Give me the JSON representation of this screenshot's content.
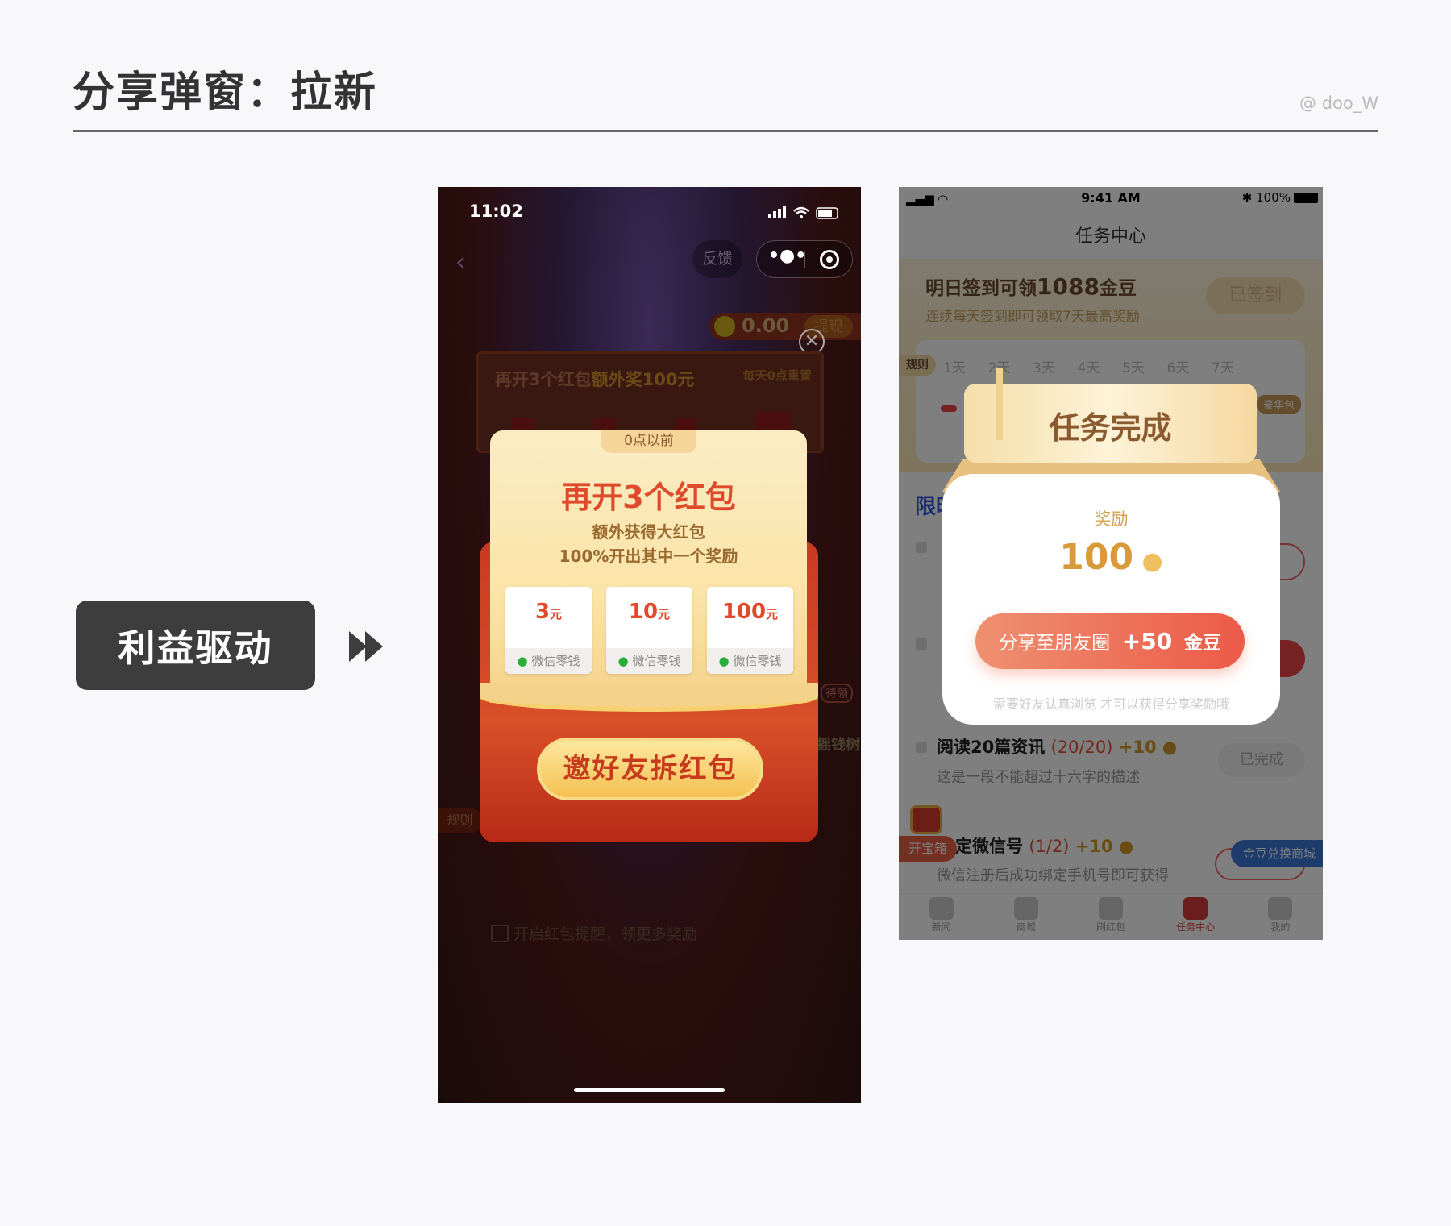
{
  "header": {
    "title": "分享弹窗：拉新",
    "watermark": "@ doo_W"
  },
  "category_tag": {
    "label": "利益驱动",
    "arrow_icon": "fast-forward-icon"
  },
  "phone1": {
    "status": {
      "time": "11:02"
    },
    "nav": {
      "feedback": "反馈"
    },
    "balance": {
      "amount": "0.00",
      "withdraw": "提现"
    },
    "banner": {
      "text_a": "再开3个红包",
      "text_b": "额外奖100元",
      "reset": "每天0点重置"
    },
    "popup": {
      "tab": "0点以前",
      "title": "再开3个红包",
      "line1": "额外获得大红包",
      "line2": "100%开出其中一个奖励",
      "rewards": [
        {
          "amount": "3",
          "unit": "元",
          "source": "微信零钱"
        },
        {
          "amount": "10",
          "unit": "元",
          "source": "微信零钱"
        },
        {
          "amount": "100",
          "unit": "元",
          "source": "微信零钱"
        }
      ],
      "cta": "邀好友拆红包"
    },
    "side": {
      "rules": "规则",
      "pending": "待领",
      "tree": "摇钱树"
    },
    "reminder": "开启红包提醒，领更多奖励"
  },
  "phone2": {
    "status": {
      "time": "9:41 AM",
      "battery": "100%"
    },
    "title": "任务中心",
    "signin": {
      "title_a": "明日签到可领",
      "amount": "1088",
      "title_b": "金豆",
      "subtitle": "连续每天签到即可领取7天最高奖励",
      "button": "已签到"
    },
    "days": {
      "rules": "规则",
      "items": [
        "1天",
        "2天",
        "3天",
        "4天",
        "5天",
        "6天",
        "7天"
      ],
      "bonus": "豪华包"
    },
    "section": "限时",
    "tasks": [
      {
        "title": "阅读20篇资讯",
        "progress": "(20/20)",
        "reward": "+10",
        "desc": "这是一段不能超过十六字的描述",
        "button": "已完成"
      },
      {
        "title": "定微信号",
        "progress": "(1/2)",
        "reward": "+10",
        "desc": "微信注册后成功绑定手机号即可获得"
      }
    ],
    "chest": "开宝箱",
    "mall": "金豆兑换商城",
    "tabs": [
      "新闻",
      "商城",
      "刷红包",
      "任务中心",
      "我的"
    ],
    "active_tab": 3,
    "popup": {
      "title": "任务完成",
      "reward_label": "奖励",
      "reward_amount": "100",
      "share": "分享至朋友圈",
      "share_bonus": "+50",
      "share_unit": "金豆",
      "note": "需要好友认真浏览 才可以获得分享奖励哦"
    }
  }
}
